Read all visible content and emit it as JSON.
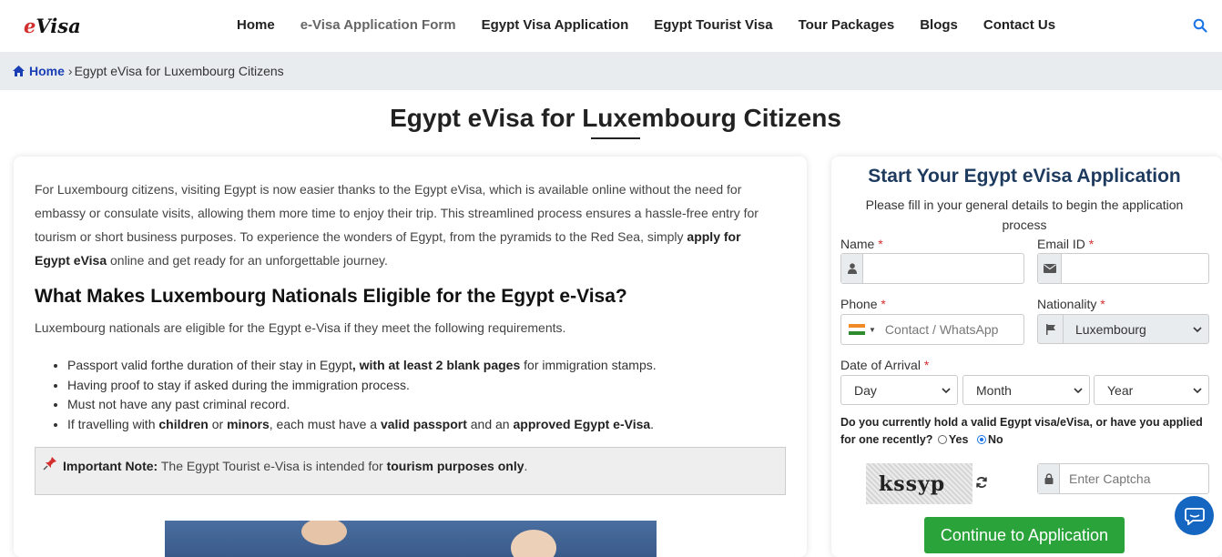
{
  "header": {
    "logo_e": "e",
    "logo_visa": "Visa",
    "nav": [
      "Home",
      "e-Visa Application Form",
      "Egypt Visa Application",
      "Egypt Tourist Visa",
      "Tour Packages",
      "Blogs",
      "Contact Us"
    ],
    "search_icon": "search-icon"
  },
  "breadcrumb": {
    "home": "Home",
    "separator": "›",
    "current": "Egypt eVisa for Luxembourg Citizens"
  },
  "page": {
    "title": "Egypt eVisa for Luxembourg Citizens"
  },
  "content": {
    "intro_part1": "For Luxembourg citizens, visiting Egypt is now easier thanks to the Egypt eVisa, which is available online without the need for embassy or consulate visits, allowing them more time to enjoy their trip. This streamlined process ensures a hassle-free entry for tourism or short business purposes. To experience the wonders of Egypt, from the pyramids to the Red Sea, simply ",
    "intro_bold": "apply for Egypt eVisa",
    "intro_part2": " online and get ready for an unforgettable journey.",
    "heading": "What Makes Luxembourg Nationals Eligible for the Egypt e-Visa?",
    "subtext": "Luxembourg nationals are eligible for the Egypt e-Visa if they meet the following requirements.",
    "req1_a": "Passport valid forthe duration of their stay in Egypt",
    "req1_b": ", with at least 2 blank pages",
    "req1_c": " for immigration stamps.",
    "req2": "Having proof to stay if asked during the immigration process.",
    "req3": "Must not have any past criminal record.",
    "req4_a": "If travelling with ",
    "req4_b": "children",
    "req4_c": " or ",
    "req4_d": "minors",
    "req4_e": ", each must have a ",
    "req4_f": "valid passport",
    "req4_g": " and an ",
    "req4_h": "approved Egypt e-Visa",
    "req4_i": ".",
    "note_label": "Important Note:",
    "note_text": " The Egypt Tourist e-Visa is intended for ",
    "note_bold": "tourism purposes only",
    "note_end": "."
  },
  "form": {
    "title": "Start Your Egypt eVisa Application",
    "subtitle": "Please fill in your general details to begin the application process",
    "name_label": "Name",
    "email_label": "Email ID",
    "phone_label": "Phone",
    "phone_placeholder": "Contact / WhatsApp",
    "nationality_label": "Nationality",
    "nationality_value": "Luxembourg",
    "arrival_label": "Date of Arrival",
    "day": "Day",
    "month": "Month",
    "year": "Year",
    "required_mark": "*",
    "question": "Do you currently hold a valid Egypt visa/eVisa, or have you applied for one recently?",
    "opt_yes": "Yes",
    "opt_no": "No",
    "selected_option": "No",
    "captcha_text": "kssyp",
    "captcha_placeholder": "Enter Captcha",
    "continue": "Continue to Application"
  },
  "colors": {
    "accent": "#1a3fb5",
    "form_title": "#1e3b5f",
    "required": "#d32f2f",
    "button": "#2aa33a",
    "chat": "#1566c0"
  }
}
